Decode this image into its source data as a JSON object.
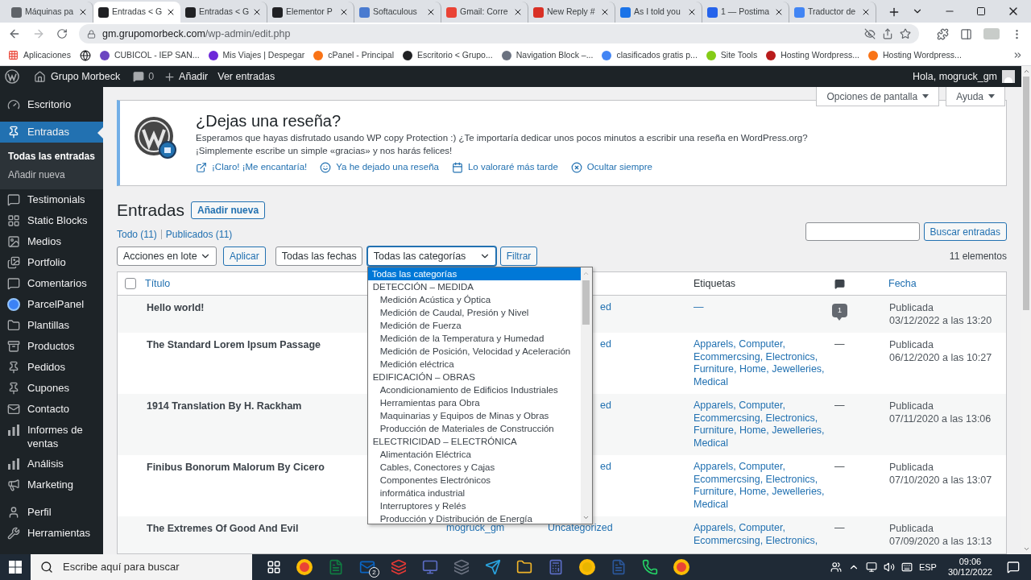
{
  "browser": {
    "tabs": [
      {
        "title": "Máquinas pa",
        "selected": false
      },
      {
        "title": "Entradas < G",
        "selected": true
      },
      {
        "title": "Entradas < G",
        "selected": false
      },
      {
        "title": "Elementor P",
        "selected": false
      },
      {
        "title": "Softaculous",
        "selected": false
      },
      {
        "title": "Gmail: Corre",
        "selected": false
      },
      {
        "title": "New Reply #",
        "selected": false
      },
      {
        "title": "As I told you",
        "selected": false
      },
      {
        "title": "1 — Postima",
        "selected": false
      },
      {
        "title": "Traductor de",
        "selected": false
      }
    ],
    "address": {
      "host": "gm.grupomorbeck.com",
      "path": "/wp-admin/edit.php"
    },
    "bookmarks": [
      "Aplicaciones",
      "CUBICOL - IEP SAN...",
      "Mis Viajes | Despegar",
      "cPanel - Principal",
      "Escritorio < Grupo...",
      "Navigation Block –...",
      "clasificados gratis p...",
      "Site Tools",
      "Hosting Wordpress...",
      "Hosting Wordpress..."
    ]
  },
  "admin_bar": {
    "site": "Grupo Morbeck",
    "comments": "0",
    "new": "Añadir",
    "view": "Ver entradas",
    "greeting": "Hola, mogruck_gm"
  },
  "screen_meta": [
    "Opciones de pantalla",
    "Ayuda"
  ],
  "sidebar": {
    "groups": [
      [
        {
          "label": "Escritorio",
          "selected": false
        }
      ],
      [
        {
          "label": "Entradas",
          "selected": true,
          "children": [
            {
              "label": "Todas las entradas",
              "selected": true
            },
            {
              "label": "Añadir nueva",
              "selected": false
            }
          ]
        },
        {
          "label": "Testimonials",
          "selected": false
        },
        {
          "label": "Static Blocks",
          "selected": false
        },
        {
          "label": "Medios",
          "selected": false
        },
        {
          "label": "Portfolio",
          "selected": false
        },
        {
          "label": "Comentarios",
          "selected": false
        },
        {
          "label": "ParcelPanel",
          "selected": false
        },
        {
          "label": "Plantillas",
          "selected": false
        },
        {
          "label": "Productos",
          "selected": false
        },
        {
          "label": "Pedidos",
          "selected": false
        },
        {
          "label": "Cupones",
          "selected": false
        },
        {
          "label": "Contacto",
          "selected": false
        },
        {
          "label": "Informes de ventas",
          "selected": false
        },
        {
          "label": "Análisis",
          "selected": false
        },
        {
          "label": "Marketing",
          "selected": false
        }
      ],
      [
        {
          "label": "Perfil",
          "selected": false
        },
        {
          "label": "Herramientas",
          "selected": false
        }
      ]
    ]
  },
  "notice": {
    "title": "¿Dejas una reseña?",
    "lines": [
      "Esperamos que hayas disfrutado usando WP copy Protection :) ¿Te importaría dedicar unos pocos minutos a escribir una reseña en WordPress.org?",
      "¡Simplemente escribe un simple «gracias» y nos harás felices!"
    ],
    "links": [
      "¡Claro! ¡Me encantaría!",
      "Ya he dejado una reseña",
      "Lo valoraré más tarde",
      "Ocultar siempre"
    ]
  },
  "heading": {
    "title": "Entradas",
    "add_new": "Añadir nueva"
  },
  "views": [
    "Todo (11)",
    "Publicados (11)"
  ],
  "search": {
    "button": "Buscar entradas"
  },
  "filters": {
    "bulk_actions": "Acciones en lote",
    "apply": "Aplicar",
    "dates": "Todas las fechas",
    "category": "Todas las categorías",
    "filter": "Filtrar",
    "count": "11 elementos"
  },
  "category_dropdown": {
    "options": [
      {
        "kind": "all",
        "label": "Todas las categorías",
        "selected": true
      },
      {
        "kind": "parent",
        "label": "DETECCIÓN – MEDIDA",
        "selected": false
      },
      {
        "kind": "child",
        "label": "Medición Acústica y Óptica",
        "selected": false
      },
      {
        "kind": "child",
        "label": "Medición de Caudal, Presión y Nivel",
        "selected": false
      },
      {
        "kind": "child",
        "label": "Medición de Fuerza",
        "selected": false
      },
      {
        "kind": "child",
        "label": "Medición de la Temperatura y Humedad",
        "selected": false
      },
      {
        "kind": "child",
        "label": "Medición de Posición, Velocidad y Aceleración",
        "selected": false
      },
      {
        "kind": "child",
        "label": "Medición eléctrica",
        "selected": false
      },
      {
        "kind": "parent",
        "label": "EDIFICACIÓN – OBRAS",
        "selected": false
      },
      {
        "kind": "child",
        "label": "Acondicionamiento de Edificios Industriales",
        "selected": false
      },
      {
        "kind": "child",
        "label": "Herramientas para Obra",
        "selected": false
      },
      {
        "kind": "child",
        "label": "Maquinarias y Equipos de Minas y Obras",
        "selected": false
      },
      {
        "kind": "child",
        "label": "Producción de Materiales de Construcción",
        "selected": false
      },
      {
        "kind": "parent",
        "label": "ELECTRICIDAD – ELECTRÓNICA",
        "selected": false
      },
      {
        "kind": "child",
        "label": "Alimentación Eléctrica",
        "selected": false
      },
      {
        "kind": "child",
        "label": "Cables, Conectores y Cajas",
        "selected": false
      },
      {
        "kind": "child",
        "label": "Componentes Electrónicos",
        "selected": false
      },
      {
        "kind": "child",
        "label": "informática industrial",
        "selected": false
      },
      {
        "kind": "child",
        "label": "Interruptores y Relés",
        "selected": false
      },
      {
        "kind": "child",
        "label": "Producción y Distribución de Energía",
        "selected": false
      }
    ]
  },
  "table": {
    "select_all": {
      "checked": false
    },
    "columns": {
      "title": "Título",
      "tags": "Etiquetas",
      "date": "Fecha"
    },
    "rows": [
      {
        "title": "Hello world!",
        "category": "ed",
        "covered": true,
        "tags": "—",
        "comments": {
          "kind": "bubble",
          "text": "1"
        },
        "status": "Publicada",
        "date": "03/12/2022 a las 13:20"
      },
      {
        "title": "The Standard Lorem Ipsum Passage",
        "category": "ed",
        "covered": true,
        "tags": "Apparels, Computer, Ecommercsing, Electronics, Furniture, Home, Jewelleries, Medical",
        "comments": {
          "kind": "none",
          "text": "—"
        },
        "status": "Publicada",
        "date": "06/12/2020 a las 10:27"
      },
      {
        "title": "1914 Translation By H. Rackham",
        "category": "ed",
        "covered": true,
        "tags": "Apparels, Computer, Ecommercsing, Electronics, Furniture, Home, Jewelleries, Medical",
        "comments": {
          "kind": "none",
          "text": "—"
        },
        "status": "Publicada",
        "date": "07/11/2020 a las 13:06"
      },
      {
        "title": "Finibus Bonorum Malorum By Cicero",
        "category": "ed",
        "covered": true,
        "tags": "Apparels, Computer, Ecommercsing, Electronics, Furniture, Home, Jewelleries, Medical",
        "comments": {
          "kind": "none",
          "text": "—"
        },
        "status": "Publicada",
        "date": "07/10/2020 a las 13:07"
      },
      {
        "title": "The Extremes Of Good And Evil",
        "author": "mogruck_gm",
        "category": "Uncategorized",
        "covered": false,
        "tags": "Apparels, Computer, Ecommercsing, Electronics,",
        "comments": {
          "kind": "none",
          "text": "—"
        },
        "status": "Publicada",
        "date": "07/09/2020 a las 13:13"
      }
    ]
  },
  "taskbar": {
    "search": "Escribe aquí para buscar",
    "mail_badge": "2",
    "language": "ESP",
    "time": "09:06",
    "date": "30/12/2022"
  }
}
